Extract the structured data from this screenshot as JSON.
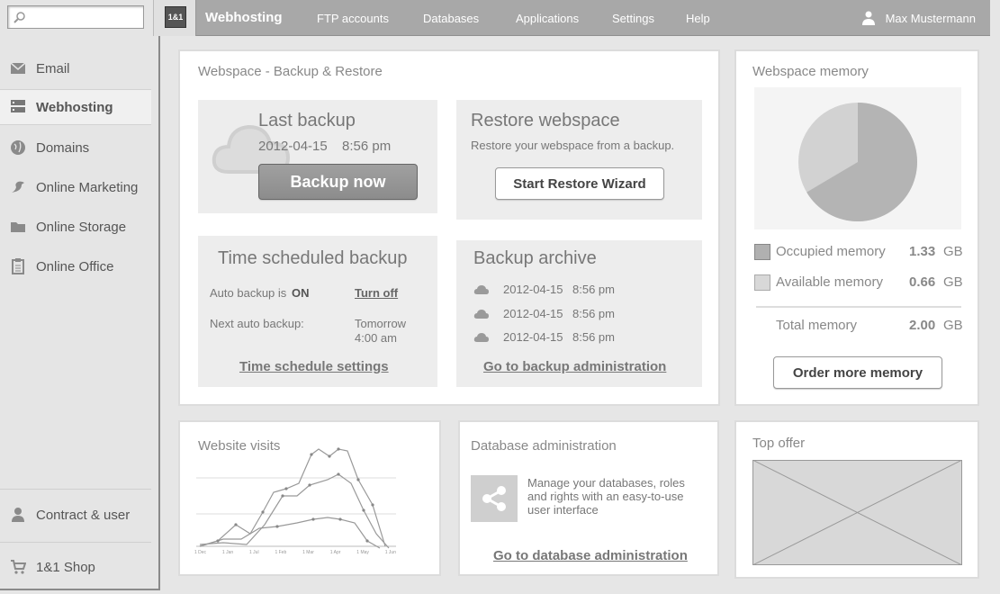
{
  "search": {
    "placeholder": ""
  },
  "sidebar": {
    "items": [
      {
        "label": "Email",
        "icon": "envelope-icon"
      },
      {
        "label": "Webhosting",
        "icon": "server-icon"
      },
      {
        "label": "Domains",
        "icon": "globe-icon"
      },
      {
        "label": "Online Marketing",
        "icon": "bird-icon"
      },
      {
        "label": "Online Storage",
        "icon": "folder-icon"
      },
      {
        "label": "Online Office",
        "icon": "clipboard-icon"
      }
    ],
    "bottom": [
      {
        "label": "Contract & user",
        "icon": "user-icon"
      },
      {
        "label": "1&1 Shop",
        "icon": "cart-icon"
      }
    ]
  },
  "header": {
    "logo": "1&1",
    "title": "Webhosting",
    "nav": [
      "FTP accounts",
      "Databases",
      "Applications",
      "Settings",
      "Help"
    ],
    "user": "Max Mustermann"
  },
  "backup": {
    "title": "Webspace - Backup & Restore",
    "last_backup": {
      "heading": "Last backup",
      "date": "2012-04-15",
      "time": "8:56 pm",
      "button": "Backup now"
    },
    "restore": {
      "heading": "Restore webspace",
      "desc": "Restore your webspace from a backup.",
      "button": "Start Restore Wizard"
    },
    "scheduled": {
      "heading": "Time scheduled backup",
      "auto_label": "Auto backup is",
      "auto_state": "ON",
      "turn_off": "Turn off",
      "next_label": "Next auto backup:",
      "next_value_line1": "Tomorrow",
      "next_value_line2": "4:00 am",
      "settings_link": "Time schedule settings"
    },
    "archive": {
      "heading": "Backup archive",
      "items": [
        {
          "date": "2012-04-15",
          "time": "8:56 pm"
        },
        {
          "date": "2012-04-15",
          "time": "8:56 pm"
        },
        {
          "date": "2012-04-15",
          "time": "8:56 pm"
        }
      ],
      "link": "Go to backup administration"
    }
  },
  "memory": {
    "title": "Webspace memory",
    "occupied_label": "Occupied memory",
    "occupied_value": "1.33",
    "available_label": "Available memory",
    "available_value": "0.66",
    "total_label": "Total memory",
    "total_value": "2.00",
    "unit": "GB",
    "button": "Order more memory",
    "colors": {
      "occupied": "#b4b4b4",
      "available": "#d2d2d2"
    }
  },
  "visits": {
    "title": "Website visits",
    "tick_labels": [
      "1 Dec",
      "1 Jan",
      "1 Jul",
      "1 Feb",
      "1 Mar",
      "1 Apr",
      "1 May",
      "1 Jun"
    ]
  },
  "database": {
    "title": "Database administration",
    "desc_line1": "Manage your databases, roles",
    "desc_line2": "and rights with an easy-to-use",
    "desc_line3": "user interface",
    "link": "Go to database administration"
  },
  "offer": {
    "title": "Top offer"
  }
}
